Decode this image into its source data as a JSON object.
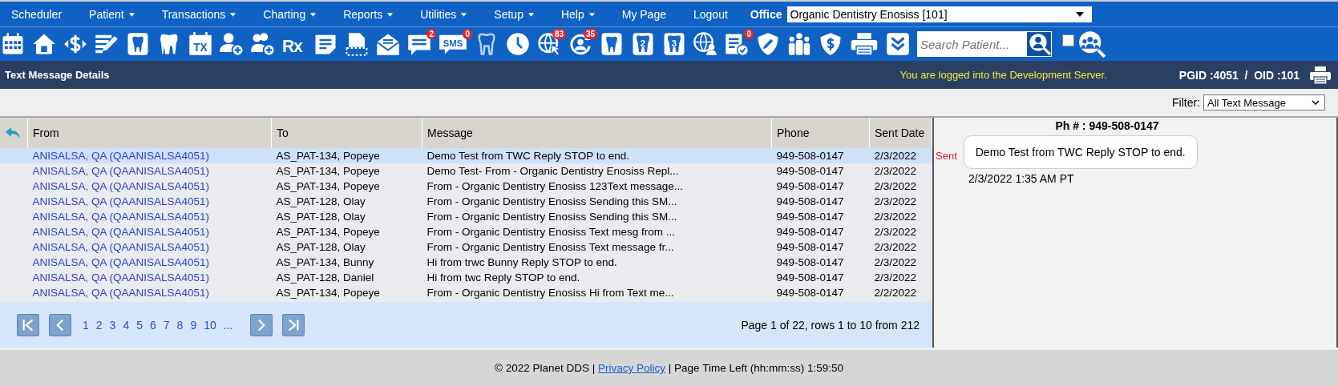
{
  "menu": [
    {
      "label": "Scheduler",
      "dropdown": false
    },
    {
      "label": "Patient",
      "dropdown": true
    },
    {
      "label": "Transactions",
      "dropdown": true
    },
    {
      "label": "Charting",
      "dropdown": true
    },
    {
      "label": "Reports",
      "dropdown": true
    },
    {
      "label": "Utilities",
      "dropdown": true
    },
    {
      "label": "Setup",
      "dropdown": true
    },
    {
      "label": "Help",
      "dropdown": true
    },
    {
      "label": "My Page",
      "dropdown": false
    },
    {
      "label": "Logout",
      "dropdown": false
    }
  ],
  "office": {
    "label": "Office",
    "value": "Organic Dentistry Enosiss [101]"
  },
  "toolbar": [
    {
      "kind": "calendar"
    },
    {
      "kind": "home"
    },
    {
      "kind": "dollar"
    },
    {
      "kind": "edit-list"
    },
    {
      "kind": "tooth-card"
    },
    {
      "kind": "tooth"
    },
    {
      "kind": "tx",
      "label": "TX"
    },
    {
      "kind": "user-add"
    },
    {
      "kind": "users-add"
    },
    {
      "kind": "rx",
      "label": "Rx"
    },
    {
      "kind": "note"
    },
    {
      "kind": "document"
    },
    {
      "kind": "envelope"
    },
    {
      "kind": "chat",
      "badge": "2"
    },
    {
      "kind": "sms",
      "label": "SMS",
      "badge": "0"
    },
    {
      "kind": "tooth-outline"
    },
    {
      "kind": "clock"
    },
    {
      "kind": "globe",
      "badge": "83"
    },
    {
      "kind": "refresh-user",
      "badge": "35"
    },
    {
      "kind": "tooth-card"
    },
    {
      "kind": "tooth-number",
      "label": "2"
    },
    {
      "kind": "tooth-number",
      "label": "3"
    },
    {
      "kind": "globe-user"
    },
    {
      "kind": "checklist",
      "badge": "0"
    },
    {
      "kind": "shield-pencil"
    },
    {
      "kind": "group"
    },
    {
      "kind": "shield-dollar"
    },
    {
      "kind": "printer"
    },
    {
      "kind": "chevrons"
    }
  ],
  "search": {
    "placeholder": "Search Patient..."
  },
  "show_all": {
    "checked": false
  },
  "header": {
    "title": "Text Message Details",
    "notice": "You are logged into the Development Server.",
    "ids": "PGID :4051  /  OID :101"
  },
  "filter": {
    "label": "Filter:",
    "value": "All Text Message"
  },
  "table": {
    "columns": [
      "From",
      "To",
      "Message",
      "Phone",
      "Sent Date"
    ],
    "rows": [
      {
        "from": "ANISALSA, QA (QAANISALSA4051)",
        "to": "AS_PAT-134, Popeye",
        "message": "Demo Test from TWC Reply STOP to end.",
        "phone": "949-508-0147",
        "sent_date": "2/3/2022",
        "selected": true
      },
      {
        "from": "ANISALSA, QA (QAANISALSA4051)",
        "to": "AS_PAT-134, Popeye",
        "message": "Demo Test- From - Organic Dentistry Enosiss Repl...",
        "phone": "949-508-0147",
        "sent_date": "2/3/2022",
        "selected": false
      },
      {
        "from": "ANISALSA, QA (QAANISALSA4051)",
        "to": "AS_PAT-134, Popeye",
        "message": "From - Organic Dentistry Enosiss 123Text message...",
        "phone": "949-508-0147",
        "sent_date": "2/3/2022",
        "selected": false
      },
      {
        "from": "ANISALSA, QA (QAANISALSA4051)",
        "to": "AS_PAT-128, Olay",
        "message": "From - Organic Dentistry Enosiss Sending this SM...",
        "phone": "949-508-0147",
        "sent_date": "2/3/2022",
        "selected": false
      },
      {
        "from": "ANISALSA, QA (QAANISALSA4051)",
        "to": "AS_PAT-128, Olay",
        "message": "From - Organic Dentistry Enosiss Sending this SM...",
        "phone": "949-508-0147",
        "sent_date": "2/3/2022",
        "selected": false
      },
      {
        "from": "ANISALSA, QA (QAANISALSA4051)",
        "to": "AS_PAT-134, Popeye",
        "message": "From - Organic Dentistry Enosiss Text mesg from ...",
        "phone": "949-508-0147",
        "sent_date": "2/3/2022",
        "selected": false
      },
      {
        "from": "ANISALSA, QA (QAANISALSA4051)",
        "to": "AS_PAT-128, Olay",
        "message": "From - Organic Dentistry Enosiss Text message fr...",
        "phone": "949-508-0147",
        "sent_date": "2/3/2022",
        "selected": false
      },
      {
        "from": "ANISALSA, QA (QAANISALSA4051)",
        "to": "AS_PAT-134, Bunny",
        "message": "Hi from trwc Bunny Reply STOP to end.",
        "phone": "949-508-0147",
        "sent_date": "2/3/2022",
        "selected": false
      },
      {
        "from": "ANISALSA, QA (QAANISALSA4051)",
        "to": "AS_PAT-128, Daniel",
        "message": "Hi from twc Reply STOP to end.",
        "phone": "949-508-0147",
        "sent_date": "2/3/2022",
        "selected": false
      },
      {
        "from": "ANISALSA, QA (QAANISALSA4051)",
        "to": "AS_PAT-134, Popeye",
        "message": "From - Organic Dentistry Enosiss Hi from Text me...",
        "phone": "949-508-0147",
        "sent_date": "2/2/2022",
        "selected": false
      }
    ]
  },
  "pager": {
    "pages": [
      "1",
      "2",
      "3",
      "4",
      "5",
      "6",
      "7",
      "8",
      "9",
      "10"
    ],
    "more": "...",
    "summary": "Page 1 of 22, rows 1 to 10 from 212"
  },
  "detail": {
    "phone": "Ph # : 949-508-0147",
    "messages": [
      {
        "status": "Sent",
        "text": "Demo Test from TWC Reply STOP to end.",
        "time": "2/3/2022 1:35 AM PT"
      }
    ]
  },
  "footer": {
    "copyright": "© 2022 Planet DDS |",
    "link": "Privacy Policy",
    "time_left": "|  Page Time Left (hh:mm:ss) 1:59:50"
  }
}
